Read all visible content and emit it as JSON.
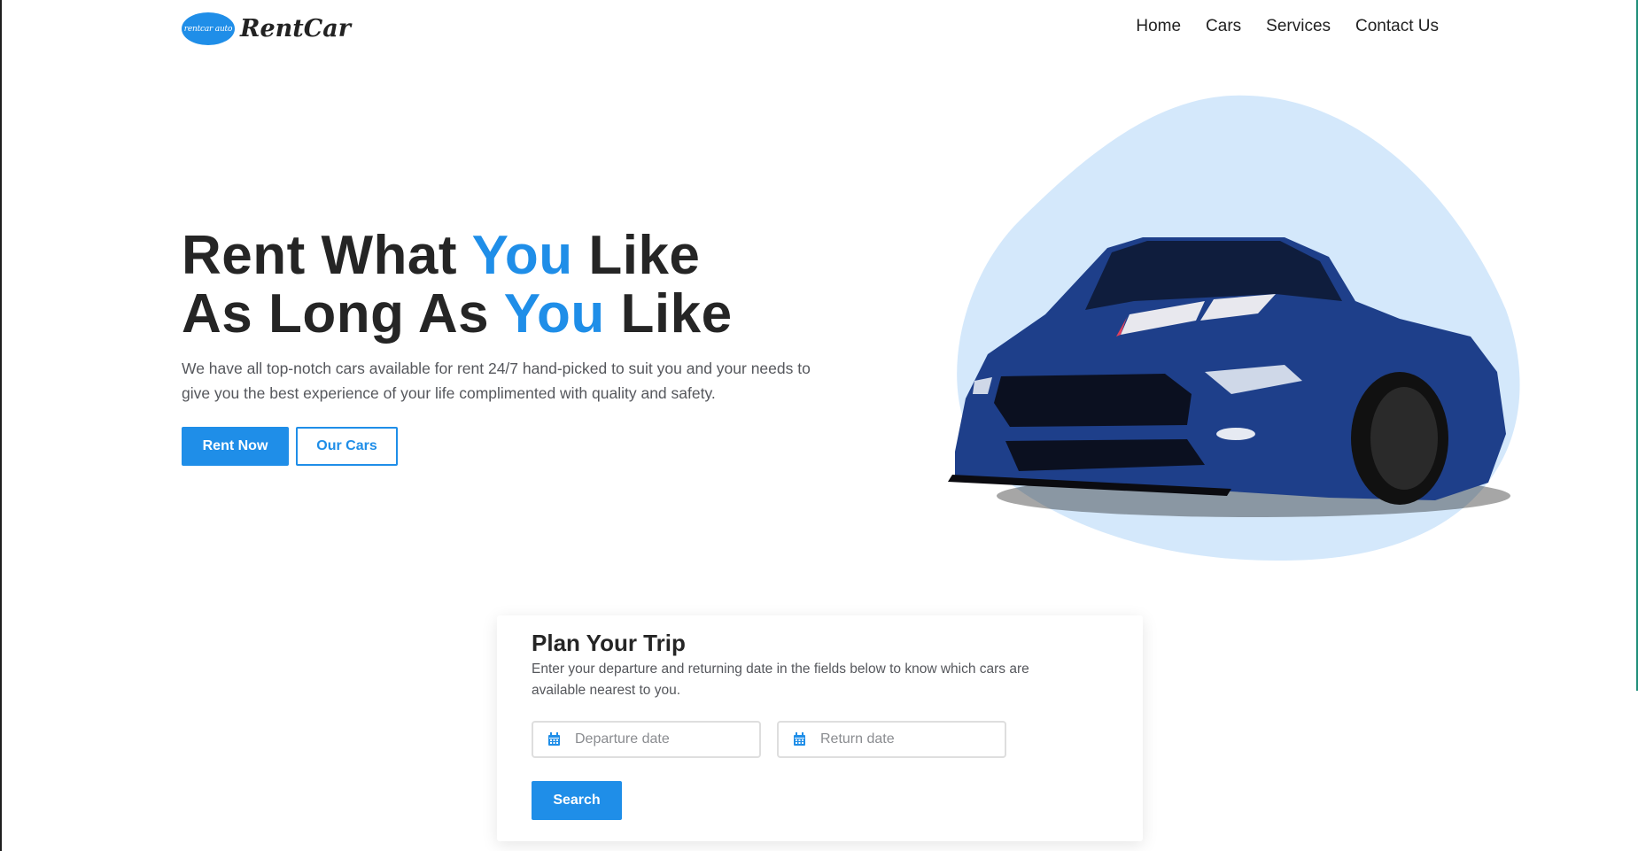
{
  "brand": {
    "logo_badge_text": "rentcar auto",
    "name": "RentCar",
    "color": "#1f8ee8"
  },
  "nav": {
    "items": [
      "Home",
      "Cars",
      "Services",
      "Contact Us"
    ]
  },
  "hero": {
    "line1_before": "Rent What ",
    "line1_accent": "You",
    "line1_after": " Like",
    "line2_before": "As Long As ",
    "line2_accent": "You",
    "line2_after": " Like",
    "description": "We have all top-notch cars available for rent 24/7 hand-picked to suit you and your needs to give you the best experience of your life complimented with quality and safety.",
    "rent_now": "Rent Now",
    "our_cars": "Our Cars",
    "image": "blue sports car"
  },
  "trip": {
    "title": "Plan Your Trip",
    "description": "Enter your departure and returning date in the fields below to know which cars are available nearest to you.",
    "departure_placeholder": "Departure date",
    "return_placeholder": "Return date",
    "search": "Search",
    "icon": "calendar-icon"
  },
  "colors": {
    "accent": "#1f8ee8",
    "blob": "#d4e8fb",
    "car_body": "#1e3f8a"
  }
}
